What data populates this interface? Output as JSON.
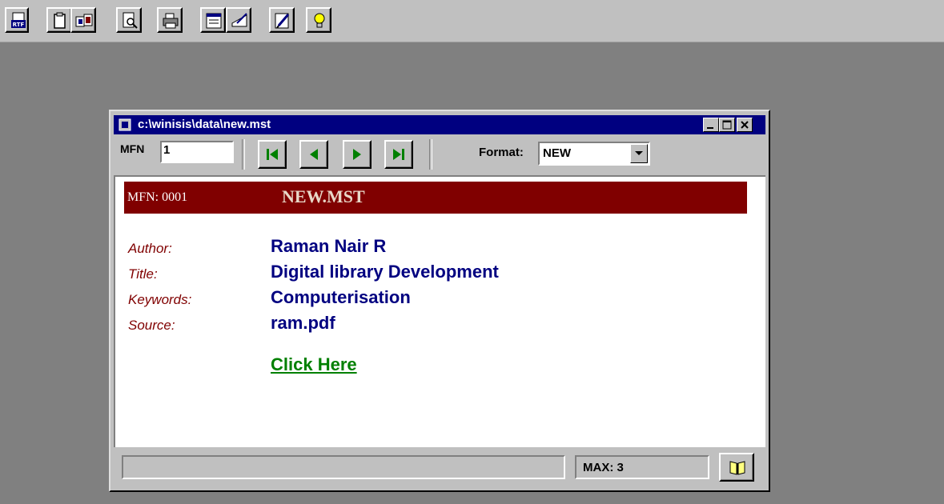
{
  "toolbar": {
    "buttons": [
      {
        "name": "rtf-export-icon",
        "label": "RTF"
      },
      {
        "name": "clipboard-icon",
        "label": ""
      },
      {
        "name": "copy-record-icon",
        "label": ""
      },
      {
        "name": "print-preview-icon",
        "label": ""
      },
      {
        "name": "printer-icon",
        "label": ""
      },
      {
        "name": "form-icon",
        "label": ""
      },
      {
        "name": "hand-edit-icon",
        "label": ""
      },
      {
        "name": "pencil-edit-icon",
        "label": ""
      },
      {
        "name": "lightbulb-icon",
        "label": ""
      }
    ]
  },
  "window": {
    "title": "c:\\winisis\\data\\new.mst",
    "controls": [
      "minimize-icon",
      "maximize-icon",
      "close-icon"
    ]
  },
  "navbar": {
    "mfn_label": "MFN",
    "mfn_value": "1",
    "format_label": "Format:",
    "format_value": "NEW"
  },
  "record": {
    "banner_mfn": "MFN: 0001",
    "banner_title": "NEW.MST",
    "fields": [
      {
        "label": "Author:",
        "value": "Raman Nair R"
      },
      {
        "label": "Title:",
        "value": "Digital library Development"
      },
      {
        "label": "Keywords:",
        "value": "Computerisation"
      },
      {
        "label": "Source:",
        "value": "ram.pdf"
      }
    ],
    "link": "Click Here"
  },
  "statusbar": {
    "status_text": "",
    "max_text": "MAX: 3"
  },
  "colors": {
    "banner": "#800000",
    "label": "#800000",
    "value": "#000080",
    "link": "#008000",
    "titlebar": "#000080"
  }
}
